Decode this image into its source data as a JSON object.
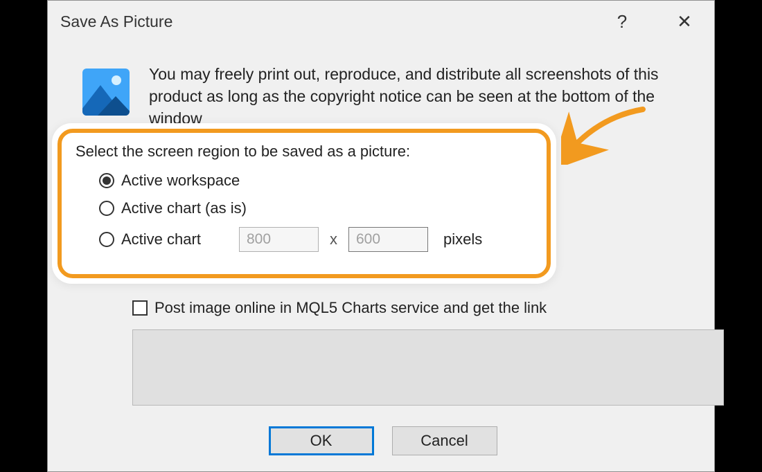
{
  "dialog": {
    "title": "Save As Picture",
    "info_text": "You may freely print out, reproduce, and distribute all screenshots of this product as long as the copyright notice can be seen at the bottom of the window",
    "section_label": "Select the screen region to be saved as a picture:",
    "options": {
      "workspace": "Active workspace",
      "chart_asis": "Active chart (as is)",
      "chart": "Active chart"
    },
    "width_value": "800",
    "height_value": "600",
    "size_sep": "x",
    "size_unit": "pixels",
    "post_label": "Post image online in MQL5 Charts service and get the link",
    "ok": "OK",
    "cancel": "Cancel",
    "help_icon": "?",
    "close_icon": "✕"
  }
}
